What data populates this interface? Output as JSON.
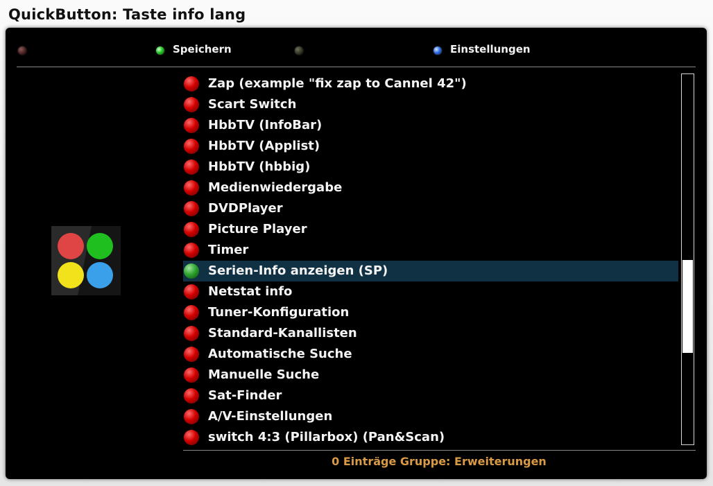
{
  "window": {
    "title": "QuickButton: Taste info lang"
  },
  "color_buttons": [
    {
      "color": "red",
      "label": ""
    },
    {
      "color": "green",
      "label": "Speichern"
    },
    {
      "color": "yellow",
      "label": ""
    },
    {
      "color": "blue",
      "label": "Einstellungen"
    }
  ],
  "logo": {
    "icon": "quickbutton-color-dots-icon",
    "colors": [
      "#e04545",
      "#1fbf1f",
      "#f2e21c",
      "#3ba0ea"
    ]
  },
  "list": {
    "selected_index": 9,
    "items": [
      {
        "label": "Zap (example \"fix zap to Cannel 42\")"
      },
      {
        "label": "Scart Switch"
      },
      {
        "label": "HbbTV (InfoBar)"
      },
      {
        "label": "HbbTV (Applist)"
      },
      {
        "label": "HbbTV (hbbig)"
      },
      {
        "label": "Medienwiedergabe"
      },
      {
        "label": "DVDPlayer"
      },
      {
        "label": "Picture Player"
      },
      {
        "label": "Timer"
      },
      {
        "label": "Serien-Info anzeigen (SP)"
      },
      {
        "label": "Netstat info"
      },
      {
        "label": "Tuner-Konfiguration"
      },
      {
        "label": "Standard-Kanallisten"
      },
      {
        "label": "Automatische Suche"
      },
      {
        "label": "Manuelle Suche"
      },
      {
        "label": "Sat-Finder"
      },
      {
        "label": "A/V-Einstellungen"
      },
      {
        "label": "switch 4:3 (Pillarbox) (Pan&Scan)"
      }
    ]
  },
  "status": {
    "text": "0 Einträge Gruppe: Erweiterungen"
  },
  "colors": {
    "status_text": "#d99a45",
    "selected_row": "#103044"
  }
}
